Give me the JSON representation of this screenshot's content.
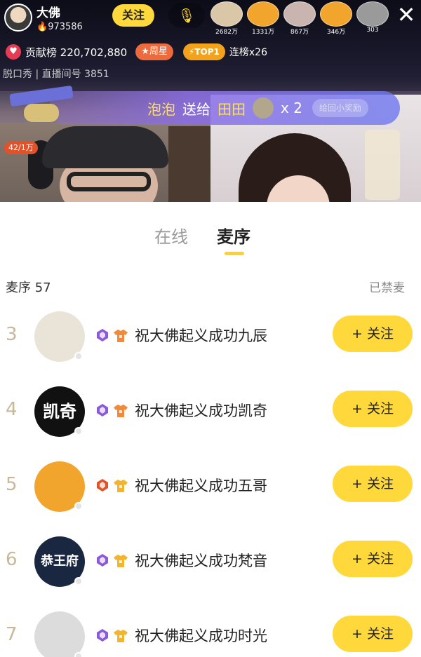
{
  "host": {
    "name": "大佛",
    "fans": "973586"
  },
  "header": {
    "follow_label": "关注"
  },
  "audience": [
    {
      "count": "2682万",
      "color": "#d9c7a8"
    },
    {
      "count": "1331万",
      "color": "#f2a52d"
    },
    {
      "count": "867万",
      "color": "#c9b4b0"
    },
    {
      "count": "346万",
      "color": "#f2a52d"
    },
    {
      "count": "303",
      "color": "#9a9a9a"
    }
  ],
  "rank": {
    "contrib_label": "贡献榜",
    "contrib_value": "220,702,880",
    "star_label": "周星",
    "top_label": "TOP1",
    "streak_label": "连榜x26"
  },
  "room": {
    "line": "脱口秀 | 直播间号 3851"
  },
  "gift": {
    "plane_count": "42/1万",
    "sender": "泡泡",
    "verb": "送给",
    "target": "田田",
    "times": "x 2",
    "pill": "给回小奖励"
  },
  "tabs": {
    "online": "在线",
    "queue": "麦序"
  },
  "queue": {
    "count_label": "麦序 57",
    "muted_label": "已禁麦"
  },
  "rows": [
    {
      "rank": "3",
      "name": "祝大佛起义成功九辰",
      "follow": "+ 关注",
      "lvl_color": "#8c5ad6",
      "shirt_color": "#f28a3b",
      "avatar_bg": "#eae4d8"
    },
    {
      "rank": "4",
      "name": "祝大佛起义成功凯奇",
      "avatar_text": "凯奇",
      "follow": "+ 关注",
      "lvl_color": "#8c5ad6",
      "shirt_color": "#f28a3b",
      "avatar_bg": "#111111"
    },
    {
      "rank": "5",
      "name": "祝大佛起义成功五哥",
      "follow": "+ 关注",
      "lvl_color": "#e0522a",
      "shirt_color": "#f2b52d",
      "avatar_bg": "#f2a52d"
    },
    {
      "rank": "6",
      "name": "祝大佛起义成功梵音",
      "avatar_text": "恭王府",
      "follow": "+ 关注",
      "lvl_color": "#8c5ad6",
      "shirt_color": "#f2b52d",
      "avatar_bg": "#1a2740"
    },
    {
      "rank": "7",
      "name": "祝大佛起义成功时光",
      "follow": "+ 关注",
      "lvl_color": "#8c5ad6",
      "shirt_color": "#f2b52d",
      "avatar_bg": "#dcdcdc"
    }
  ]
}
